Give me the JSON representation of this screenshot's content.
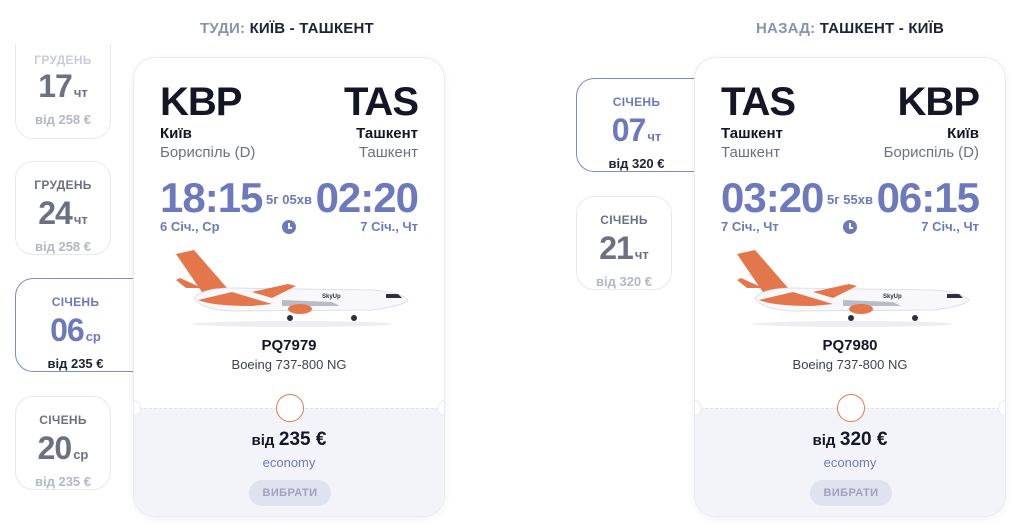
{
  "outbound": {
    "title_lead": "ТУДИ:",
    "title_route": "КИЇВ - ТАШКЕНТ",
    "dates": [
      {
        "month": "ГРУДЕНЬ",
        "day": "17",
        "weekday": "чт",
        "price": "від 258 €"
      },
      {
        "month": "ГРУДЕНЬ",
        "day": "24",
        "weekday": "чт",
        "price": "від 258 €"
      },
      {
        "month": "СІЧЕНЬ",
        "day": "06",
        "weekday": "ср",
        "price": "від 235 €"
      },
      {
        "month": "СІЧЕНЬ",
        "day": "20",
        "weekday": "ср",
        "price": "від 235 €"
      }
    ],
    "card": {
      "dep_code": "KBP",
      "dep_city": "Київ",
      "dep_airport": "Бориспіль (D)",
      "arr_code": "TAS",
      "arr_city": "Ташкент",
      "arr_airport": "Ташкент",
      "dep_time": "18:15",
      "dep_date": "6 Січ., Ср",
      "duration": "5г 05хв",
      "arr_time": "02:20",
      "arr_date": "7 Січ., Чт",
      "flight_no": "PQ7979",
      "aircraft": "Boeing 737-800 NG",
      "price_from": "від",
      "price_amount": "235 €",
      "class": "economy",
      "choose_label": "ВИБРАТИ",
      "airline_logo": "SkyUp"
    }
  },
  "return": {
    "title_lead": "НАЗАД:",
    "title_route": "ТАШКЕНТ - КИЇВ",
    "dates": [
      {
        "month": "СІЧЕНЬ",
        "day": "07",
        "weekday": "чт",
        "price": "від 320 €"
      },
      {
        "month": "СІЧЕНЬ",
        "day": "21",
        "weekday": "чт",
        "price": "від 320 €"
      }
    ],
    "card": {
      "dep_code": "TAS",
      "dep_city": "Ташкент",
      "dep_airport": "Ташкент",
      "arr_code": "KBP",
      "arr_city": "Київ",
      "arr_airport": "Бориспіль (D)",
      "dep_time": "03:20",
      "dep_date": "7 Січ., Чт",
      "duration": "5г 55хв",
      "arr_time": "06:15",
      "arr_date": "7 Січ., Чт",
      "flight_no": "PQ7980",
      "aircraft": "Boeing 737-800 NG",
      "price_from": "від",
      "price_amount": "320 €",
      "class": "economy",
      "choose_label": "ВИБРАТИ",
      "airline_logo": "SkyUp"
    }
  },
  "colors": {
    "accent": "#6c79bd",
    "orange": "#e3764a",
    "text": "#141625",
    "muted": "#6c7082"
  }
}
